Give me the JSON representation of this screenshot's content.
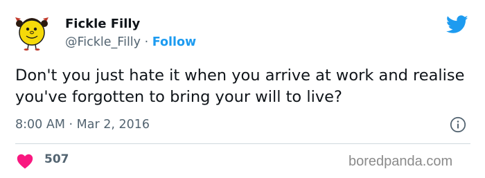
{
  "user": {
    "display_name": "Fickle Filly",
    "handle": "@Fickle_Filly",
    "separator": "·",
    "follow_label": "Follow",
    "avatar_icon": "little-miss-character-avatar"
  },
  "tweet": {
    "text": "Don't you just hate it when you arrive at work and realise you've forgotten to bring your will to live?",
    "time": "8:00 AM",
    "date_separator": "·",
    "date": "Mar 2, 2016"
  },
  "engagement": {
    "likes": "507",
    "like_icon": "heart-icon"
  },
  "icons": {
    "platform": "twitter-bird-icon",
    "info": "info-icon"
  },
  "watermark": "boredpanda.com",
  "colors": {
    "twitter_blue": "#1d9bf0",
    "heart_red": "#f91880",
    "text_primary": "#0f1419",
    "text_secondary": "#536471",
    "divider": "#cfd9de"
  }
}
